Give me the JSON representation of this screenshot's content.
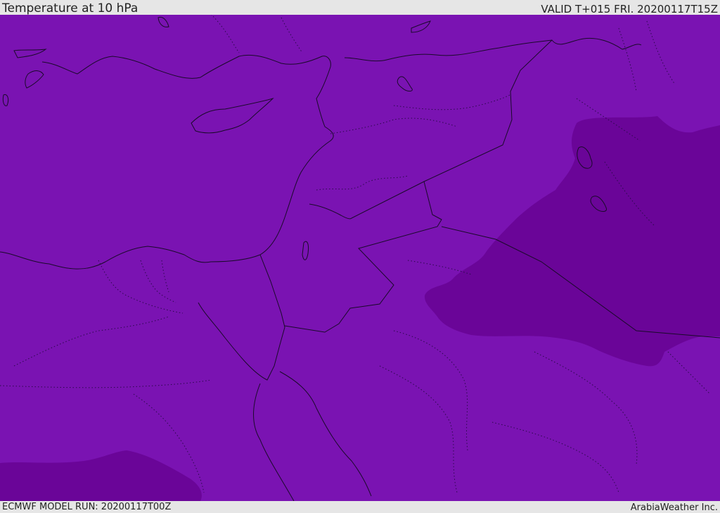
{
  "header": {
    "title": "Temperature at 10 hPa",
    "valid": "VALID T+015 FRI. 20200117T15Z"
  },
  "footer": {
    "run": "ECMWF MODEL RUN: 20200117T00Z",
    "credit": "ArabiaWeather Inc."
  },
  "map": {
    "colors": {
      "field_primary": "#7a13b2",
      "field_colder": "#6a0598",
      "coastline": "#1a0a2a",
      "border": "#1a0a2a"
    }
  }
}
